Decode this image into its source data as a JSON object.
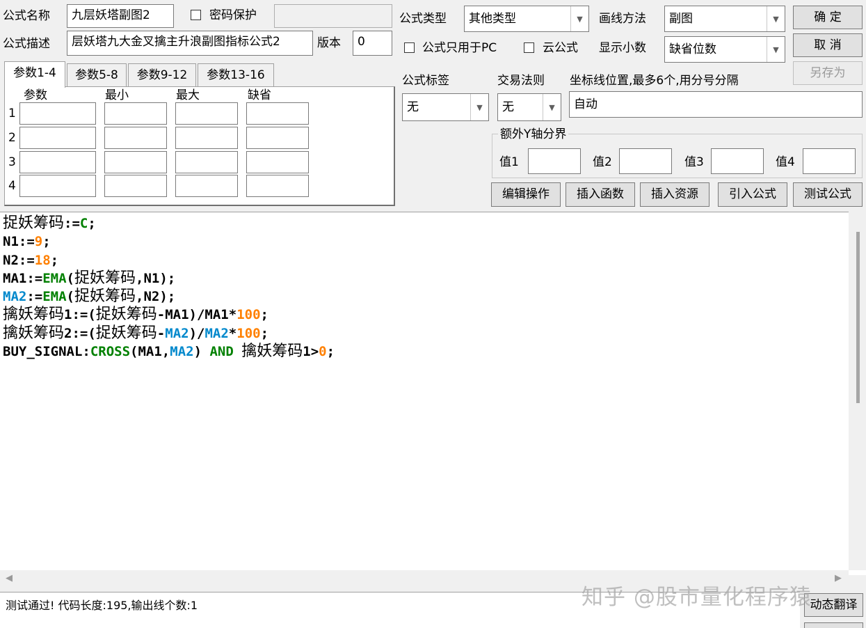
{
  "top": {
    "name_label": "公式名称",
    "name_value": "九层妖塔副图2",
    "password_label": "密码保护",
    "password_value": "",
    "desc_label": "公式描述",
    "desc_value": "层妖塔九大金叉擒主升浪副图指标公式2",
    "version_label": "版本",
    "version_value": "0",
    "type_label": "公式类型",
    "type_value": "其他类型",
    "draw_label": "画线方法",
    "draw_value": "副图",
    "pc_only_label": "公式只用于PC",
    "cloud_label": "云公式",
    "decimal_label": "显示小数",
    "decimal_value": "缺省位数"
  },
  "buttons": {
    "ok": "确 定",
    "cancel": "取 消",
    "save_as": "另存为",
    "edit": "编辑操作",
    "insert_func": "插入函数",
    "insert_res": "插入资源",
    "import": "引入公式",
    "test": "测试公式",
    "dynamic_translate": "动态翻译"
  },
  "tabs": [
    "参数1-4",
    "参数5-8",
    "参数9-12",
    "参数13-16"
  ],
  "params": {
    "headers": [
      "参数",
      "最小",
      "最大",
      "缺省"
    ],
    "rows": [
      "1",
      "2",
      "3",
      "4"
    ]
  },
  "right": {
    "tag_label": "公式标签",
    "tag_value": "无",
    "rule_label": "交易法则",
    "rule_value": "无",
    "axis_label": "坐标线位置,最多6个,用分号分隔",
    "axis_value": "自动",
    "extra_y_label": "额外Y轴分界",
    "val1": "值1",
    "val2": "值2",
    "val3": "值3",
    "val4": "值4"
  },
  "code_colors": {
    "default": "#000000",
    "number": "#ff8000",
    "function": "#008000",
    "variable": "#0088cc"
  },
  "code_lines": [
    [
      {
        "t": "捉妖筹码",
        "c": "cn"
      },
      {
        "t": ":="
      },
      {
        "t": "C",
        "c": "function"
      },
      {
        "t": ";"
      }
    ],
    [
      {
        "t": "N1:="
      },
      {
        "t": "9",
        "c": "number"
      },
      {
        "t": ";"
      }
    ],
    [
      {
        "t": "N2:="
      },
      {
        "t": "18",
        "c": "number"
      },
      {
        "t": ";"
      }
    ],
    [
      {
        "t": "MA1:="
      },
      {
        "t": "EMA",
        "c": "function"
      },
      {
        "t": "("
      },
      {
        "t": "捉妖筹码",
        "c": "cn"
      },
      {
        "t": ",N1);"
      }
    ],
    [
      {
        "t": "MA2",
        "c": "variable"
      },
      {
        "t": ":="
      },
      {
        "t": "EMA",
        "c": "function"
      },
      {
        "t": "("
      },
      {
        "t": "捉妖筹码",
        "c": "cn"
      },
      {
        "t": ",N2);"
      }
    ],
    [
      {
        "t": "擒妖筹码",
        "c": "cn"
      },
      {
        "t": "1:=("
      },
      {
        "t": "捉妖筹码",
        "c": "cn"
      },
      {
        "t": "-MA1)/MA1*"
      },
      {
        "t": "100",
        "c": "number"
      },
      {
        "t": ";"
      }
    ],
    [
      {
        "t": "擒妖筹码",
        "c": "cn"
      },
      {
        "t": "2:=("
      },
      {
        "t": "捉妖筹码",
        "c": "cn"
      },
      {
        "t": "-"
      },
      {
        "t": "MA2",
        "c": "variable"
      },
      {
        "t": ")/"
      },
      {
        "t": "MA2",
        "c": "variable"
      },
      {
        "t": "*"
      },
      {
        "t": "100",
        "c": "number"
      },
      {
        "t": ";"
      }
    ],
    [
      {
        "t": "BUY_SIGNAL:"
      },
      {
        "t": "CROSS",
        "c": "function"
      },
      {
        "t": "(MA1,"
      },
      {
        "t": "MA2",
        "c": "variable"
      },
      {
        "t": ") "
      },
      {
        "t": "AND",
        "c": "function"
      },
      {
        "t": " "
      },
      {
        "t": "擒妖筹码",
        "c": "cn"
      },
      {
        "t": "1>"
      },
      {
        "t": "0",
        "c": "number"
      },
      {
        "t": ";"
      }
    ]
  ],
  "status_text": "测试通过! 代码长度:195,输出线个数:1",
  "watermark": "知乎 @股市量化程序猿"
}
